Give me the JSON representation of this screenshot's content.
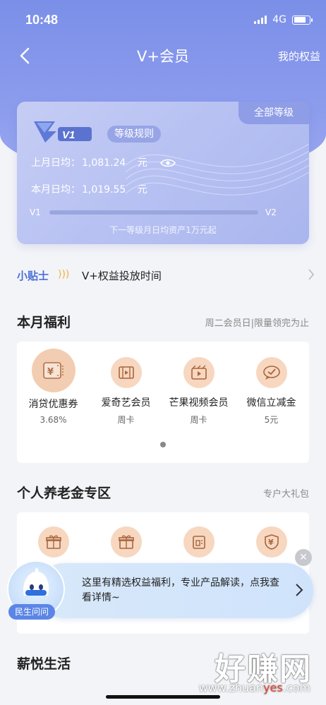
{
  "status_bar": {
    "time": "10:48",
    "network": "4G"
  },
  "nav": {
    "title": "V+会员",
    "right_label": "我的权益"
  },
  "card": {
    "tag": "全部等级",
    "level_badge": "V1",
    "level_rules": "等级规则",
    "last_month_label": "上月日均：",
    "last_month_value": "1,081.24",
    "last_month_unit": "元",
    "this_month_label": "本月日均：",
    "this_month_value": "1,019.55",
    "this_month_unit": "元",
    "progress_from": "V1",
    "progress_to": "V2",
    "progress_fraction": 0.0,
    "progress_hint": "下一等级月日均资产1万元起"
  },
  "tips": {
    "label": "小贴士",
    "wave": ")))",
    "text": "V+权益投放时间"
  },
  "monthly": {
    "title": "本月福利",
    "subtitle": "周二会员日|限量领完为止",
    "items": [
      {
        "name": "消贷优惠券",
        "sub": "3.68%",
        "icon": "coupon-icon"
      },
      {
        "name": "爱奇艺会员",
        "sub": "周卡",
        "icon": "film-icon"
      },
      {
        "name": "芒果视频会员",
        "sub": "周卡",
        "icon": "video-icon"
      },
      {
        "name": "微信立减金",
        "sub": "5元",
        "icon": "wechat-icon"
      }
    ]
  },
  "pension": {
    "title": "个人养老金专区",
    "subtitle": "专户大礼包",
    "icons": [
      "gift-icon",
      "gift-icon",
      "calendar-icon",
      "yuan-shield-icon"
    ]
  },
  "popup": {
    "text": "这里有精选权益福利，专业产品解读，点我查看详情~",
    "avatar_label": "民生问问"
  },
  "salary": {
    "title": "薪悦生活"
  },
  "watermark": {
    "brand": "好赚网",
    "url_pre": "www.zhuan",
    "url_hl": "yes",
    "url_post": ".com"
  },
  "colors": {
    "primary": "#7b8fe8",
    "accent_orange": "#f2cdb1",
    "tips_blue": "#4a6fd8"
  }
}
